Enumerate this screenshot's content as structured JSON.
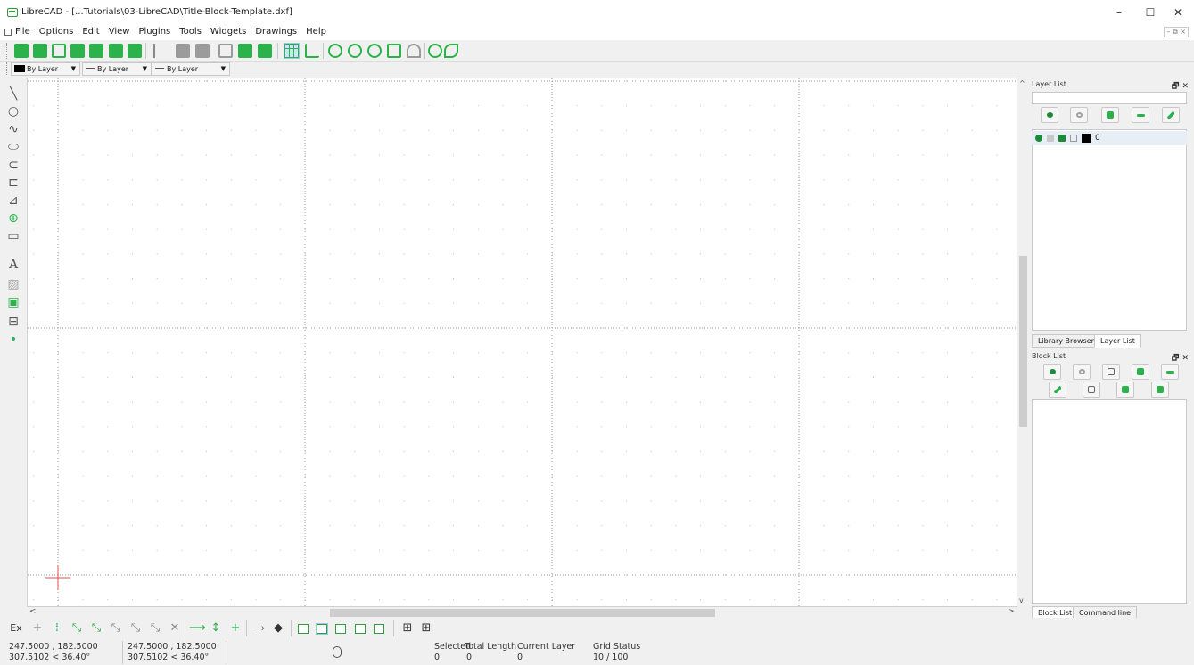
{
  "window": {
    "title": "LibreCAD - [...Tutorials\\03-LibreCAD\\Title-Block-Template.dxf]",
    "minimize": "–",
    "maximize": "☐",
    "close": "✕",
    "mdi_controls": "– ⧉ ×"
  },
  "menu": [
    "File",
    "Options",
    "Edit",
    "View",
    "Plugins",
    "Tools",
    "Widgets",
    "Drawings",
    "Help"
  ],
  "pen_toolbar": {
    "color": "By Layer",
    "width": "By Layer",
    "linetype": "By Layer"
  },
  "right_dock": {
    "layer_panel_title": "Layer List",
    "layer_filter_placeholder": "",
    "layers": [
      {
        "name": "0",
        "color": "#000000"
      }
    ],
    "tabs_top": [
      "Library Browser",
      "Layer List"
    ],
    "block_panel_title": "Block List",
    "tabs_bottom": [
      "Block List",
      "Command line"
    ],
    "panel_ctrls": "🗗 ✕"
  },
  "status": {
    "abs_coord_cart": "247.5000 , 182.5000",
    "abs_coord_polar": "307.5102 < 36.40°",
    "rel_coord_cart": "247.5000 , 182.5000",
    "rel_coord_polar": "307.5102 < 36.40°",
    "selected_label": "Selected",
    "selected_value": "0",
    "total_length_label": "Total Length",
    "total_length_value": "0",
    "current_layer_label": "Current Layer",
    "current_layer_value": "0",
    "grid_status_label": "Grid Status",
    "grid_status_value": "10 / 100"
  },
  "snap_toolbar": {
    "exclusive_label": "Ex"
  },
  "left_tools_text_icon": "A",
  "colors": {
    "accent_green": "#2bb24a",
    "crosshair": "#e84c4c",
    "grid_dot": "#bfbfbf",
    "grid_line": "#9a9a9a"
  }
}
